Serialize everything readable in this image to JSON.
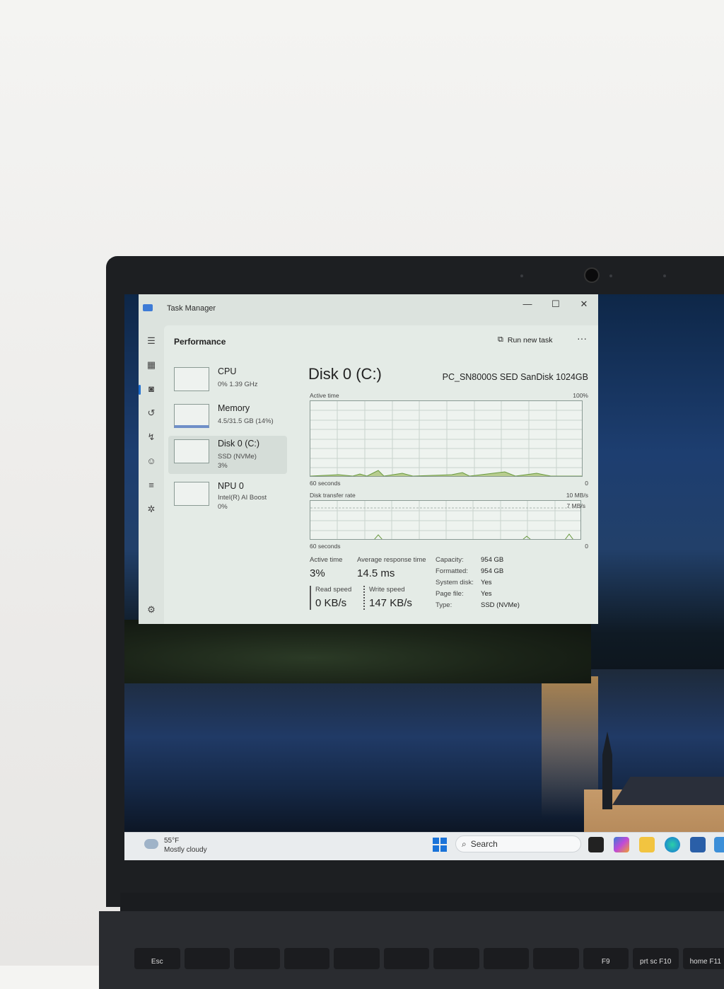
{
  "window": {
    "title": "Task Manager",
    "minimize": "—",
    "maximize": "☐",
    "close": "✕"
  },
  "header": {
    "section": "Performance",
    "run_new_task": "Run new task",
    "more": "···"
  },
  "resources": [
    {
      "name": "CPU",
      "sub1": "0%  1.39 GHz",
      "sub2": ""
    },
    {
      "name": "Memory",
      "sub1": "4.5/31.5 GB (14%)",
      "sub2": ""
    },
    {
      "name": "Disk 0 (C:)",
      "sub1": "SSD (NVMe)",
      "sub2": "3%"
    },
    {
      "name": "NPU 0",
      "sub1": "Intel(R) AI Boost",
      "sub2": "0%"
    }
  ],
  "detail": {
    "title": "Disk 0 (C:)",
    "model": "PC_SN8000S SED SanDisk 1024GB",
    "graph1": {
      "label": "Active time",
      "max": "100%",
      "time": "60 seconds",
      "min": "0"
    },
    "graph2": {
      "label": "Disk transfer rate",
      "max": "10 MB/s",
      "inner": "7 MB/s",
      "time": "60 seconds",
      "min": "0"
    },
    "stats": {
      "active_time_label": "Active time",
      "active_time": "3%",
      "avg_response_label": "Average response time",
      "avg_response": "14.5 ms",
      "read_label": "Read speed",
      "read": "0 KB/s",
      "write_label": "Write speed",
      "write": "147 KB/s"
    },
    "properties": [
      {
        "label": "Capacity:",
        "value": "954 GB"
      },
      {
        "label": "Formatted:",
        "value": "954 GB"
      },
      {
        "label": "System disk:",
        "value": "Yes"
      },
      {
        "label": "Page file:",
        "value": "Yes"
      },
      {
        "label": "Type:",
        "value": "SSD (NVMe)"
      }
    ]
  },
  "taskbar": {
    "temp": "55°F",
    "weather": "Mostly cloudy",
    "search": "Search"
  },
  "keyboard": [
    "Esc",
    "",
    "",
    "",
    "",
    "",
    "",
    "",
    "",
    "F9",
    "prt sc F10",
    "home F11"
  ],
  "colors": {
    "accent": "#1f6fd0",
    "graph_line": "#6a9a40",
    "pane": "#e4ebe6"
  }
}
